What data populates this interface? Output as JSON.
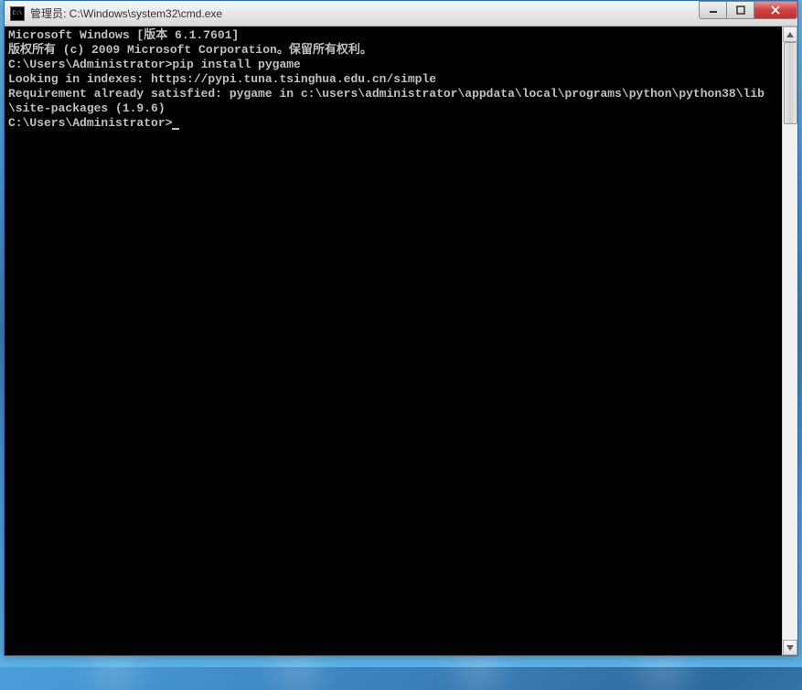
{
  "window": {
    "title": "管理员: C:\\Windows\\system32\\cmd.exe"
  },
  "terminal": {
    "lines": [
      "Microsoft Windows [版本 6.1.7601]",
      "版权所有 (c) 2009 Microsoft Corporation。保留所有权利。",
      "",
      "C:\\Users\\Administrator>pip install pygame",
      "Looking in indexes: https://pypi.tuna.tsinghua.edu.cn/simple",
      "Requirement already satisfied: pygame in c:\\users\\administrator\\appdata\\local\\programs\\python\\python38\\lib\\site-packages (1.9.6)",
      "",
      "C:\\Users\\Administrator>"
    ]
  }
}
